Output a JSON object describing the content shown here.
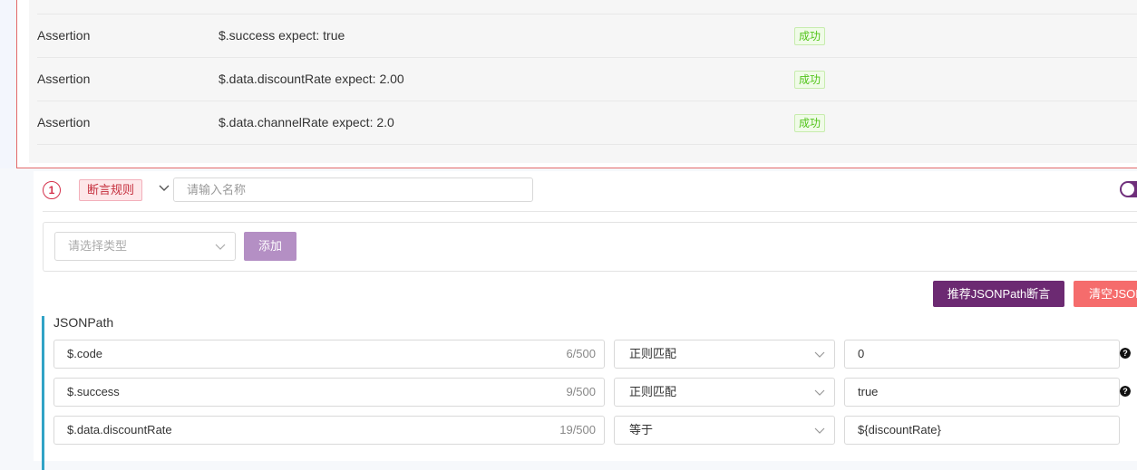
{
  "results": [
    {
      "type": "Assertion",
      "content": "$.success expect: true",
      "status": "成功"
    },
    {
      "type": "Assertion",
      "content": "$.data.discountRate expect: 2.00",
      "status": "成功"
    },
    {
      "type": "Assertion",
      "content": "$.data.channelRate expect: 2.0",
      "status": "成功"
    }
  ],
  "rule": {
    "index": "1",
    "tag": "断言规则",
    "name_placeholder": "请输入名称",
    "type_placeholder": "请选择类型",
    "add_label": "添加",
    "recommend_label": "推荐JSONPath断言",
    "clear_label": "清空JSONPath断言",
    "jsonpath_title": "JSONPath",
    "jsonpath_rows": [
      {
        "path": "$.code",
        "count": "6/500",
        "op": "正则匹配",
        "expected": "0"
      },
      {
        "path": "$.success",
        "count": "9/500",
        "op": "正则匹配",
        "expected": "true"
      },
      {
        "path": "$.data.discountRate",
        "count": "19/500",
        "op": "等于",
        "expected": "${discountRate}"
      }
    ]
  },
  "colors": {
    "accent": "#6c2a72",
    "success": "#52c41a",
    "danger": "#f56c6c",
    "tag": "#c5303e"
  },
  "icons": {
    "chevron": "chevron-down-icon",
    "help": "question-circle-icon"
  }
}
